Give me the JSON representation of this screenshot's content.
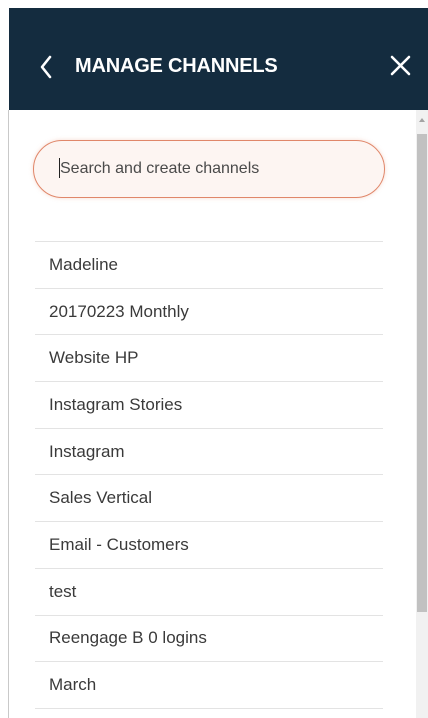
{
  "header": {
    "title": "MANAGE CHANNELS",
    "back_icon": "chevron-left-icon",
    "close_icon": "close-icon",
    "background": "#142c3f"
  },
  "search": {
    "placeholder": "Search and create channels",
    "value": "",
    "border_color": "#e0876a"
  },
  "channels": [
    {
      "label": "Madeline"
    },
    {
      "label": "20170223 Monthly"
    },
    {
      "label": "Website HP"
    },
    {
      "label": "Instagram Stories"
    },
    {
      "label": "Instagram"
    },
    {
      "label": "Sales Vertical"
    },
    {
      "label": "Email - Customers"
    },
    {
      "label": "test"
    },
    {
      "label": "Reengage B 0 logins"
    },
    {
      "label": "March"
    }
  ]
}
